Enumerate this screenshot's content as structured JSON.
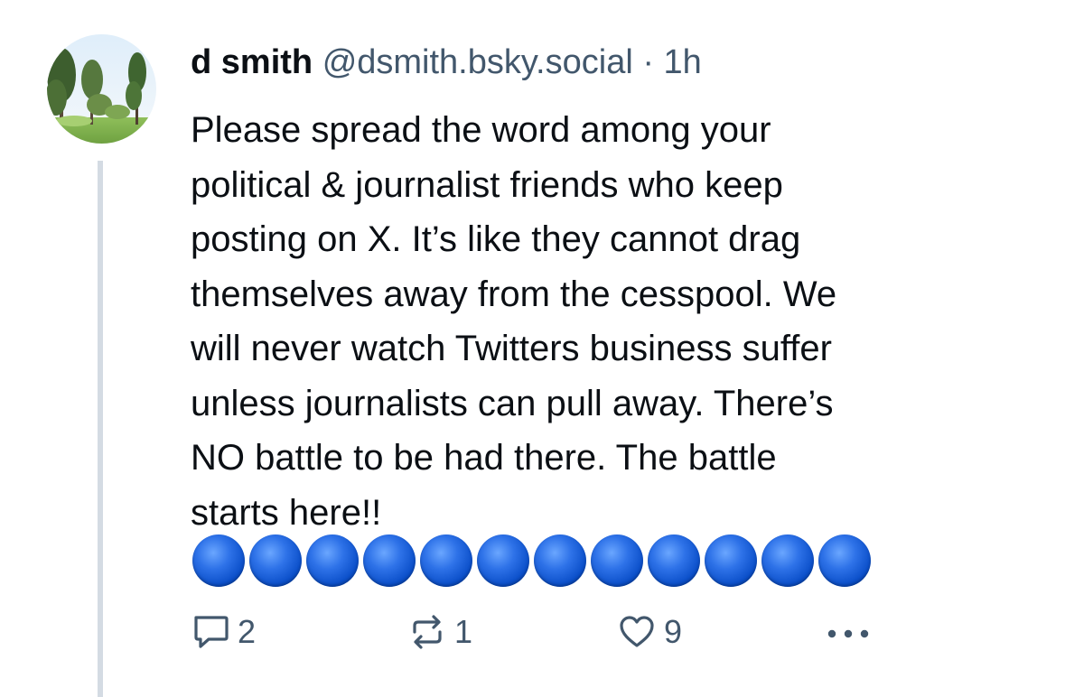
{
  "post": {
    "author": {
      "display_name": "d smith",
      "handle": "@dsmith.bsky.social",
      "separator": "·",
      "time": "1h"
    },
    "text_lines": [
      "Please spread the word among your",
      "political & journalist friends who keep",
      "posting on X. It’s like they cannot drag",
      "themselves away from the cesspool. We",
      "will never watch Twitters business suffer",
      "unless journalists can pull away. There’s",
      "NO battle to be had there. The battle",
      "starts here!!"
    ],
    "emoji_circles": [
      "blue-circle",
      "blue-circle",
      "blue-circle",
      "blue-circle",
      "blue-circle",
      "blue-circle",
      "blue-circle",
      "blue-circle",
      "blue-circle",
      "blue-circle",
      "blue-circle",
      "blue-circle"
    ],
    "actions": {
      "reply_count": "2",
      "repost_count": "1",
      "like_count": "9",
      "reply_icon": "reply-icon",
      "repost_icon": "repost-icon",
      "like_icon": "heart-icon",
      "more_icon": "more-options-icon"
    }
  },
  "colors": {
    "text": "#0b0f14",
    "muted": "#42576c",
    "thread_line": "#d4dbe3",
    "emoji_blue": "#2e72e8"
  }
}
